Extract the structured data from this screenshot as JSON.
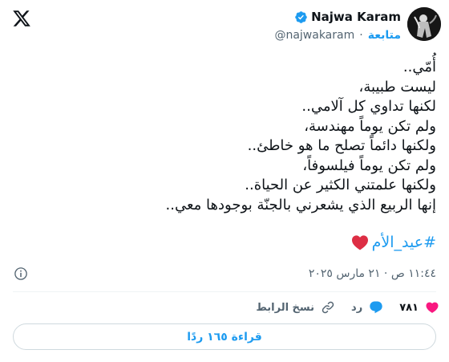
{
  "author": {
    "name": "Najwa Karam",
    "handle": "@najwakaram",
    "follow_label": "متابعة",
    "separator": "·"
  },
  "tweet": {
    "lines": [
      "أُمّي..",
      "ليست طبيبة،",
      "لكنها تداوي كل آلامي..",
      "ولم تكن يوماً مهندسة،",
      "ولكنها دائماً تصلح ما هو خاطئ..",
      "ولم تكن يوماً فيلسوفاً،",
      "ولكنها علمتني الكثير عن الحياة..",
      "إنها الربيع الذي يشعرني بالجنّة بوجودها معي.."
    ],
    "hashtag": "#عيد_الأم",
    "emoji": "red-heart"
  },
  "timestamp": "١١:٤٤ ص · ٢١ مارس ٢٠٢٥",
  "actions": {
    "likes": "٧٨١",
    "reply_label": "رد",
    "copy_link_label": "نسخ الرابط"
  },
  "read_replies_label": "قراءة ١٦٥ ردًا",
  "colors": {
    "accent": "#1d9bf0",
    "like": "#f91880",
    "secondary_text": "#536471",
    "border": "#cfd9de"
  },
  "icons": [
    "x-logo-icon",
    "verified-badge-icon",
    "info-icon",
    "heart-icon",
    "reply-bubble-icon",
    "link-icon"
  ]
}
